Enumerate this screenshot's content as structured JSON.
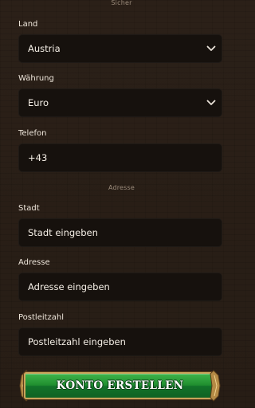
{
  "form": {
    "section_top": "Sicher",
    "section_address": "Adresse",
    "country": {
      "label": "Land",
      "value": "Austria",
      "icon": "chevron-down-icon"
    },
    "currency": {
      "label": "Währung",
      "value": "Euro",
      "icon": "chevron-down-icon"
    },
    "phone": {
      "label": "Telefon",
      "value": "+43"
    },
    "city": {
      "label": "Stadt",
      "placeholder": "Stadt eingeben"
    },
    "address": {
      "label": "Adresse",
      "placeholder": "Adresse eingeben"
    },
    "postcode": {
      "label": "Postleitzahl",
      "placeholder": "Postleitzahl eingeben"
    },
    "submit_label": "KONTO ERSTELLEN"
  },
  "colors": {
    "background": "#2a1f17",
    "field_background": "#16110d",
    "cta_green": "#1f8e2f",
    "cta_border_gold": "#c9a35a"
  }
}
